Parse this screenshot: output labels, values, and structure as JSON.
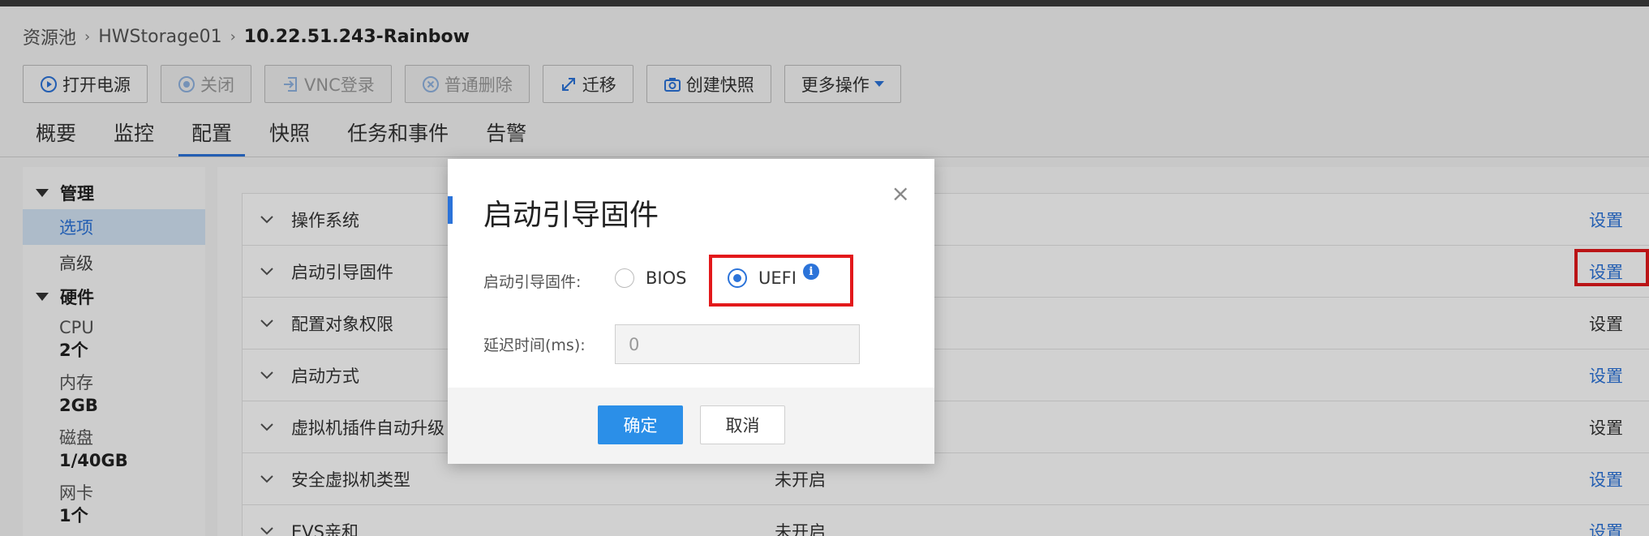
{
  "breadcrumb": {
    "items": [
      "资源池",
      "HWStorage01"
    ],
    "current": "10.22.51.243-Rainbow"
  },
  "toolbar": {
    "power_on": "打开电源",
    "power_off": "关闭",
    "vnc": "VNC登录",
    "delete": "普通删除",
    "migrate": "迁移",
    "snapshot": "创建快照",
    "more": "更多操作"
  },
  "tabs": [
    "概要",
    "监控",
    "配置",
    "快照",
    "任务和事件",
    "告警"
  ],
  "sidebar": {
    "manage_group": "管理",
    "options": "选项",
    "advanced": "高级",
    "hardware_group": "硬件",
    "cpu": {
      "label": "CPU",
      "value": "2个"
    },
    "memory": {
      "label": "内存",
      "value": "2GB"
    },
    "disk": {
      "label": "磁盘",
      "value": "1/40GB"
    },
    "nic": {
      "label": "网卡",
      "value": "1个"
    }
  },
  "rows": [
    {
      "label": "操作系统",
      "value": "",
      "action": "设置"
    },
    {
      "label": "启动引导固件",
      "value": "",
      "action": "设置"
    },
    {
      "label": "配置对象权限",
      "value": "",
      "action": "设置"
    },
    {
      "label": "启动方式",
      "value": "",
      "action": "设置"
    },
    {
      "label": "虚拟机插件自动升级",
      "value": "",
      "action": "设置"
    },
    {
      "label": "安全虚拟机类型",
      "value": "未开启",
      "action": "设置"
    },
    {
      "label": "EVS亲和",
      "value": "未开启",
      "action": "设置"
    }
  ],
  "dialog": {
    "title": "启动引导固件",
    "close": "×",
    "firmware_label": "启动引导固件:",
    "option_bios": "BIOS",
    "option_uefi": "UEFI",
    "selected": "UEFI",
    "info_glyph": "i",
    "delay_label": "延迟时间(ms):",
    "delay_value": "0",
    "ok": "确定",
    "cancel": "取消"
  },
  "colors": {
    "accent": "#2b73d9",
    "highlight": "#e3191b"
  }
}
